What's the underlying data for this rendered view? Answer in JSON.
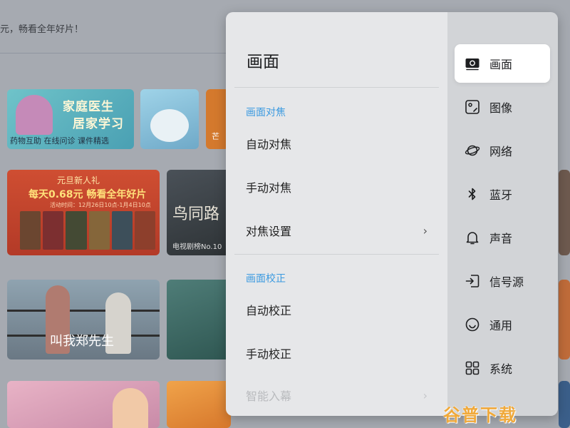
{
  "background": {
    "banner": "元，畅看全年好片！",
    "tiles": {
      "doctor": {
        "line1": "家庭医生",
        "line2": "居家学习",
        "line3": "药物互助 在线问诊 课件精选"
      },
      "orange": "芒",
      "promo": {
        "line1": "元旦新人礼",
        "line2": "每天0.68元 畅看全年好片",
        "line3": "活动时间：12月26日10点-1月4日10点"
      },
      "drama": {
        "title": "鸟同路",
        "caption": "电视剧榜No.10"
      },
      "couple": {
        "title": "叫我郑先生"
      }
    }
  },
  "panel": {
    "title": "画面",
    "sections": [
      {
        "header": "画面对焦",
        "options": [
          {
            "label": "自动对焦",
            "chevron": ""
          },
          {
            "label": "手动对焦",
            "chevron": ""
          },
          {
            "label": "对焦设置",
            "chevron": "›"
          }
        ]
      },
      {
        "header": "画面校正",
        "options": [
          {
            "label": "自动校正",
            "chevron": ""
          },
          {
            "label": "手动校正",
            "chevron": ""
          },
          {
            "label": "智能入幕",
            "chevron": "›"
          }
        ]
      }
    ]
  },
  "nav": {
    "items": [
      {
        "label": "画面",
        "icon": "screen-icon",
        "active": true
      },
      {
        "label": "图像",
        "icon": "image-icon",
        "active": false
      },
      {
        "label": "网络",
        "icon": "planet-icon",
        "active": false
      },
      {
        "label": "蓝牙",
        "icon": "bluetooth-icon",
        "active": false
      },
      {
        "label": "声音",
        "icon": "bell-icon",
        "active": false
      },
      {
        "label": "信号源",
        "icon": "input-source-icon",
        "active": false
      },
      {
        "label": "通用",
        "icon": "smile-icon",
        "active": false
      },
      {
        "label": "系统",
        "icon": "grid-icon",
        "active": false
      }
    ]
  },
  "watermark": "谷普下载",
  "colors": {
    "accent": "#3b9ae0",
    "watermark": "#f0a93a"
  }
}
